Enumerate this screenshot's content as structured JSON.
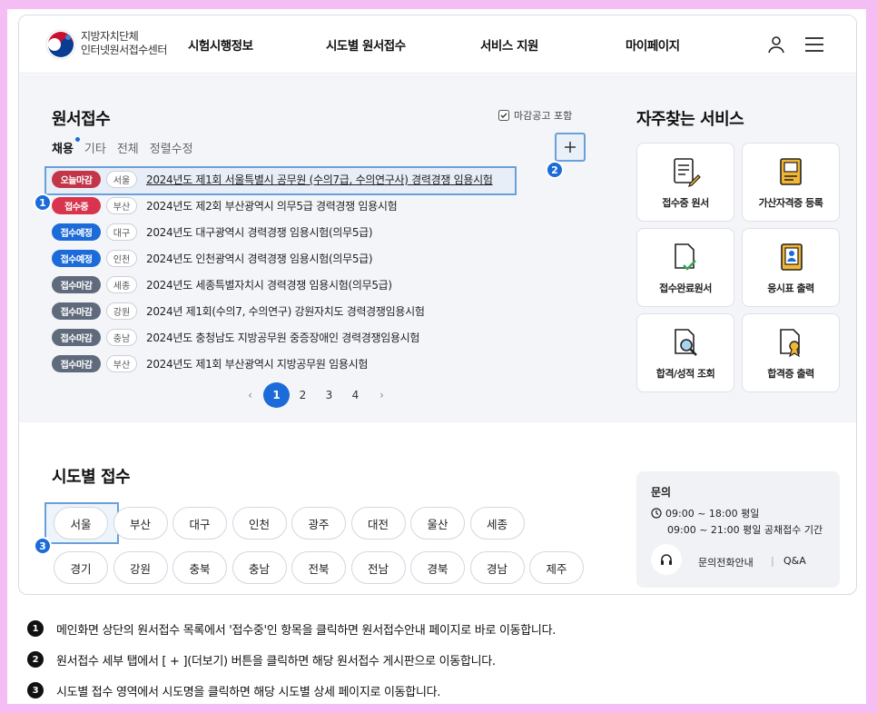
{
  "header": {
    "logo_line1": "지방자치단체",
    "logo_line2": "인터넷원서접수센터",
    "nav": [
      "시험시행정보",
      "시도별 원서접수",
      "서비스 지원",
      "마이페이지"
    ]
  },
  "apply": {
    "title": "원서접수",
    "include_closed": "마감공고 포함",
    "tabs": [
      "채용",
      "기타",
      "전체",
      "정렬수정"
    ],
    "items": [
      {
        "status": "오늘마감",
        "color": "#c3364a",
        "region": "서울",
        "title": "2024년도 제1회 서울특별시 공무원 (수의7급, 수의연구사) 경력경쟁 임용시험"
      },
      {
        "status": "접수중",
        "color": "#d9344e",
        "region": "부산",
        "title": "2024년도 제2회 부산광역시 의무5급 경력경쟁 임용시험"
      },
      {
        "status": "접수예정",
        "color": "#1c6bd8",
        "region": "대구",
        "title": "2024년도 대구광역시 경력경쟁 임용시험(의무5급)"
      },
      {
        "status": "접수예정",
        "color": "#1c6bd8",
        "region": "인천",
        "title": "2024년도 인천광역시 경력경쟁 임용시험(의무5급)"
      },
      {
        "status": "접수마감",
        "color": "#5f6b7c",
        "region": "세종",
        "title": "2024년도 세종특별자치시 경력경쟁 임용시험(의무5급)"
      },
      {
        "status": "접수마감",
        "color": "#5f6b7c",
        "region": "강원",
        "title": "2024년 제1회(수의7, 수의연구) 강원자치도 경력경쟁임용시험"
      },
      {
        "status": "접수마감",
        "color": "#5f6b7c",
        "region": "충남",
        "title": "2024년도 충청남도 지방공무원 중증장애인 경력경쟁임용시험"
      },
      {
        "status": "접수마감",
        "color": "#5f6b7c",
        "region": "부산",
        "title": "2024년도 제1회 부산광역시 지방공무원 임용시험"
      }
    ],
    "pages": [
      "1",
      "2",
      "3",
      "4"
    ],
    "prev": "‹",
    "next": "›"
  },
  "favorites": {
    "title": "자주찾는 서비스",
    "items": [
      {
        "label": "접수중 원서",
        "icon": "document-pen-icon"
      },
      {
        "label": "가산자격증 등록",
        "icon": "certificate-icon"
      },
      {
        "label": "접수완료원서",
        "icon": "document-check-icon"
      },
      {
        "label": "응시표 출력",
        "icon": "id-card-icon"
      },
      {
        "label": "합격/성적 조회",
        "icon": "document-search-icon"
      },
      {
        "label": "합격증 출력",
        "icon": "award-document-icon"
      }
    ]
  },
  "regions": {
    "title": "시도별 접수",
    "row1": [
      "서울",
      "부산",
      "대구",
      "인천",
      "광주",
      "대전",
      "울산",
      "세종"
    ],
    "row2": [
      "경기",
      "강원",
      "충북",
      "충남",
      "전북",
      "전남",
      "경북",
      "경남",
      "제주"
    ]
  },
  "contact": {
    "title": "문의",
    "hours_weekday": "09:00 ~ 18:00 평일",
    "hours_period": "09:00 ~ 21:00 평일 공채접수 기간",
    "phone_link": "문의전화안내",
    "separator": "|",
    "qna_link": "Q&A"
  },
  "markers": [
    "1",
    "2",
    "3"
  ],
  "notes": [
    {
      "num": "1",
      "text": "메인화면 상단의 원서접수 목록에서 '접수중'인 항목을 클릭하면 원서접수안내 페이지로 바로 이동합니다."
    },
    {
      "num": "2",
      "text": "원서접수 세부 탭에서 [ + ](더보기) 버튼을 클릭하면 해당 원서접수 게시판으로 이동합니다."
    },
    {
      "num": "3",
      "text": "시도별 접수 영역에서 시도명을 클릭하면 해당 시도별 상세 페이지로 이동합니다."
    }
  ],
  "colors": {
    "accent": "#1c6bd8",
    "highlight_border": "#6aa0d8",
    "frame": "#f4bdf4"
  }
}
